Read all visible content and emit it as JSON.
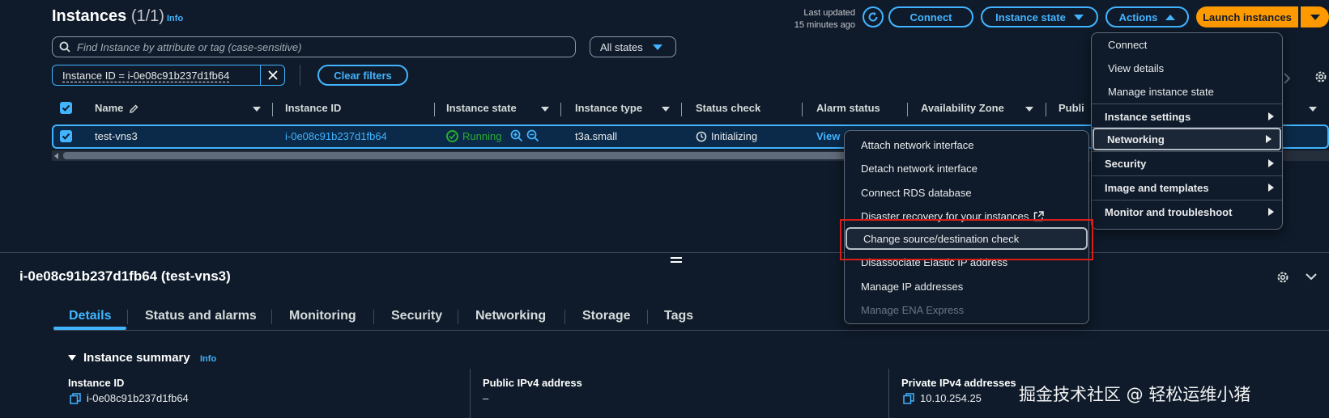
{
  "header": {
    "title": "Instances",
    "count": "(1/1)",
    "info": "Info",
    "last_updated_line1": "Last updated",
    "last_updated_line2": "15 minutes ago",
    "connect": "Connect",
    "instance_state": "Instance state",
    "actions": "Actions",
    "launch": "Launch instances"
  },
  "search": {
    "placeholder": "Find Instance by attribute or tag (case-sensitive)",
    "states": "All states"
  },
  "filter": {
    "token": "Instance ID = i-0e08c91b237d1fb64",
    "clear": "Clear filters"
  },
  "table": {
    "columns": [
      "Name",
      "Instance ID",
      "Instance state",
      "Instance type",
      "Status check",
      "Alarm status",
      "Availability Zone",
      "Publi"
    ],
    "row": {
      "name": "test-vns3",
      "id": "i-0e08c91b237d1fb64",
      "state": "Running",
      "type": "t3a.small",
      "status": "Initializing",
      "alarm": "View"
    }
  },
  "actions_menu": {
    "items": [
      "Connect",
      "View details",
      "Manage instance state"
    ],
    "groups": [
      "Instance settings",
      "Networking",
      "Security",
      "Image and templates",
      "Monitor and troubleshoot"
    ]
  },
  "networking_menu": {
    "items": [
      "Attach network interface",
      "Detach network interface",
      "Connect RDS database",
      "Disaster recovery for your instances",
      "Change source/destination check",
      "Disassociate Elastic IP address",
      "Manage IP addresses",
      "Manage ENA Express"
    ]
  },
  "details": {
    "title": "i-0e08c91b237d1fb64 (test-vns3)",
    "tabs": [
      "Details",
      "Status and alarms",
      "Monitoring",
      "Security",
      "Networking",
      "Storage",
      "Tags"
    ],
    "summary_heading": "Instance summary",
    "summary_info": "Info",
    "fields": [
      {
        "label": "Instance ID",
        "value": "i-0e08c91b237d1fb64"
      },
      {
        "label": "Public IPv4 address",
        "value": "–"
      },
      {
        "label": "Private IPv4 addresses",
        "value": "10.10.254.25"
      }
    ]
  },
  "watermark": "掘金技术社区 @ 轻松运维小猪",
  "colors": {
    "background": "#0f1b2a",
    "accent": "#42b4ff",
    "primary": "#ff9900",
    "running": "#29ad32",
    "highlight_border": "#d91e18"
  }
}
